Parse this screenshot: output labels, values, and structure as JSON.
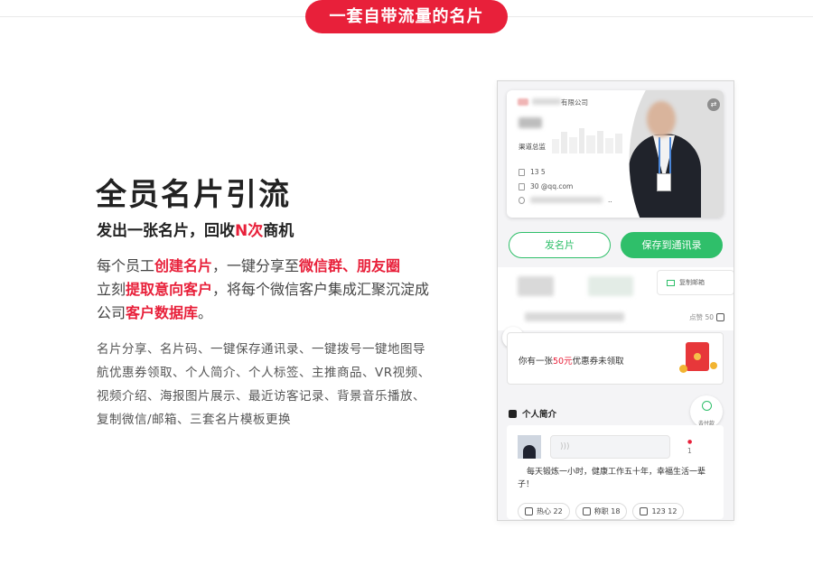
{
  "banner": {
    "label": "一套自带流量的名片"
  },
  "hero": {
    "title": "全员名片引流",
    "subtitle": {
      "prefix": "发出一张名片，回收",
      "highlight": "N次",
      "suffix": "商机"
    },
    "paragraph": {
      "p1": "每个员工",
      "h1": "创建名片",
      "p2": "，一键分享至",
      "h2": "微信群、朋友圈",
      "p3": "立刻",
      "h3": "提取意向客户",
      "p4": "，将每个微信客户集成汇聚沉淀成公司",
      "h4": "客户数据库",
      "p5": "。"
    },
    "features": "名片分享、名片码、一键保存通讯录、一键拨号一键地图导航优惠券领取、个人简介、个人标签、主推商品、VR视频、视频介绍、海报图片展示、最近访客记录、背景音乐播放、复制微信/邮箱、三套名片模板更换"
  },
  "phone": {
    "card": {
      "company_suffix": "有限公司",
      "role": "渠道总监",
      "phone": "13          5",
      "email": "30          @qq.com",
      "address": ".."
    },
    "buttons": {
      "send": "发名片",
      "save": "保存到通讯录"
    },
    "copy_mail": "复制邮箱",
    "likes": {
      "label": "点赞 50"
    },
    "coupon": {
      "prefix": "你有一张",
      "amount": "50元",
      "suffix": "优惠券未领取"
    },
    "pay": {
      "label": "去付款"
    },
    "section": {
      "title": "个人简介"
    },
    "voice": {
      "duration": "1"
    },
    "intro_text": "每天锻炼一小时，健康工作五十年，幸福生活一辈子！",
    "tags": [
      {
        "label": "热心 22"
      },
      {
        "label": "称职 18"
      },
      {
        "label": "123 12"
      }
    ]
  },
  "colors": {
    "accent_red": "#e8203a",
    "accent_green": "#2fbf6a"
  }
}
